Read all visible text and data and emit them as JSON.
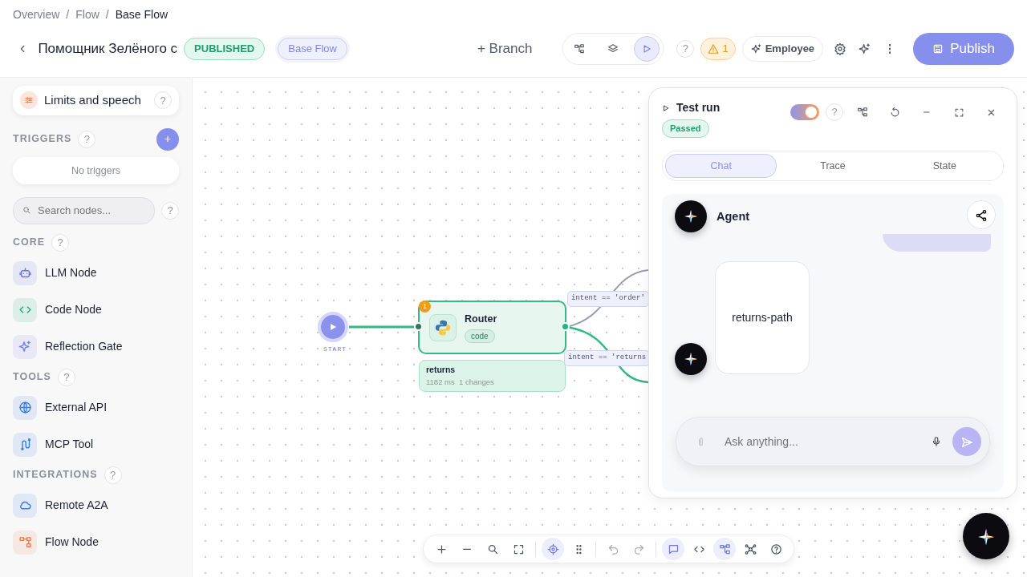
{
  "breadcrumbs": [
    {
      "label": "Overview",
      "current": false
    },
    {
      "separator": "/",
      "label": "Flow",
      "current": false
    },
    {
      "separator": "/",
      "label": "Base Flow",
      "current": true
    }
  ],
  "header": {
    "title": "Помощник Зелёного с",
    "status": "PUBLISHED",
    "flow_chip": "Base Flow",
    "branch": "Branch",
    "branch_icon": "+",
    "view_modes": [
      {
        "kind": "tree",
        "selected": false
      },
      {
        "kind": "layers",
        "selected": false
      },
      {
        "kind": "play",
        "selected": true
      }
    ],
    "help": "?",
    "warnings": "1",
    "employee": "Employee",
    "publish": "Publish"
  },
  "sidebar": {
    "limits": "Limits and speech",
    "help": "?",
    "triggers_title": "TRIGGERS",
    "add_trigger": "+",
    "empty_triggers": "No triggers",
    "search_placeholder": "Search nodes...",
    "sections": [
      {
        "title": "CORE",
        "items": [
          {
            "label": "LLM Node",
            "kind": "robot",
            "color": "#6f74e0"
          },
          {
            "label": "Code Node",
            "kind": "code",
            "color": "#1fae7a"
          },
          {
            "label": "Reflection Gate",
            "kind": "sparkle",
            "color": "#7b7fe8"
          }
        ]
      },
      {
        "title": "TOOLS",
        "items": [
          {
            "label": "External API",
            "kind": "globe",
            "color": "#3b7de0"
          },
          {
            "label": "MCP Tool",
            "kind": "plug",
            "color": "#3b7de0"
          }
        ]
      },
      {
        "title": "INTEGRATIONS",
        "items": [
          {
            "label": "Remote A2A",
            "kind": "cloud",
            "color": "#3b7de0"
          },
          {
            "label": "Flow Node",
            "kind": "flow",
            "color": "#f07a4b"
          }
        ]
      }
    ]
  },
  "canvas": {
    "start_label": "START",
    "node": {
      "title": "Router",
      "tag": "code",
      "badge": "1"
    },
    "result": {
      "title": "returns",
      "meta": "1182 ms  1 changes"
    },
    "edges": [
      {
        "label": "intent == 'order'",
        "active": false
      },
      {
        "label": "intent == 'returns",
        "active": true
      }
    ]
  },
  "test_panel": {
    "title": "Test run",
    "status": "Passed",
    "toggle_on": true,
    "help": "?",
    "tabs": [
      {
        "label": "Chat",
        "selected": true
      },
      {
        "label": "Trace",
        "selected": false
      },
      {
        "label": "State",
        "selected": false
      }
    ],
    "agent_name": "Agent",
    "messages": [
      {
        "kind": "user"
      },
      {
        "kind": "agent",
        "text": "returns-path"
      }
    ],
    "input_placeholder": "Ask anything..."
  },
  "toolbar": [
    {
      "kind": "plus",
      "selected": false
    },
    {
      "kind": "minus",
      "selected": false
    },
    {
      "kind": "search",
      "selected": false
    },
    {
      "kind": "fit",
      "selected": false
    },
    {
      "kind": "target",
      "selected": true
    },
    {
      "kind": "grid",
      "selected": false
    },
    {
      "kind": "undo",
      "selected": false
    },
    {
      "kind": "redo",
      "selected": false
    },
    {
      "kind": "chat",
      "selected": true
    },
    {
      "kind": "code",
      "selected": false
    },
    {
      "kind": "tree",
      "selected": true
    },
    {
      "kind": "network",
      "selected": false
    },
    {
      "kind": "help",
      "selected": false
    }
  ]
}
